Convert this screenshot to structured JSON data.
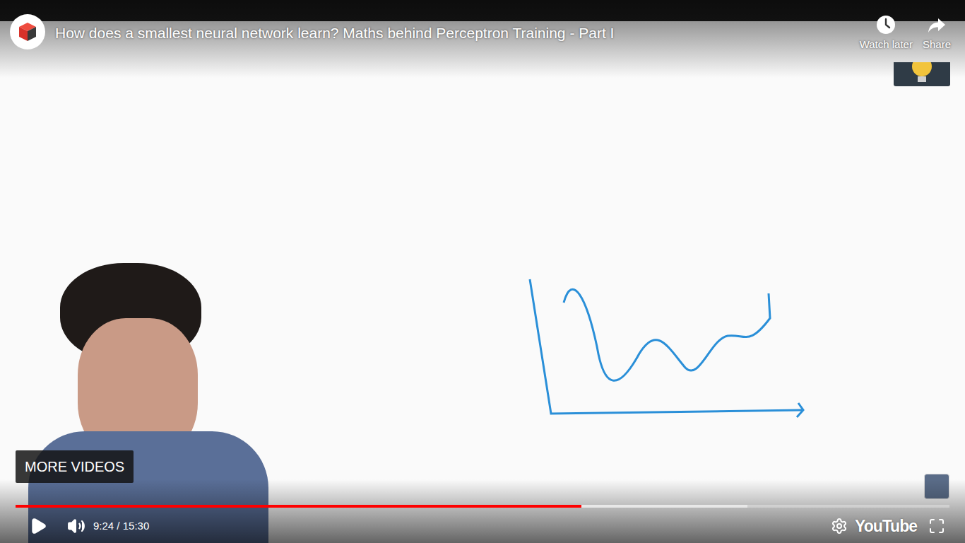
{
  "video": {
    "title": "How does a smallest neural network learn? Maths behind Perceptron Training - Part I",
    "playing": false,
    "muted": false
  },
  "top_actions": [
    {
      "label": "Watch later"
    },
    {
      "label": "Share"
    }
  ],
  "more_videos": {
    "label": "MORE VIDEOS"
  },
  "progress": {
    "level": 0.606,
    "buffered": 0.784
  },
  "time": "9:24 / 15:30",
  "logo": {
    "label": "YouTube"
  }
}
